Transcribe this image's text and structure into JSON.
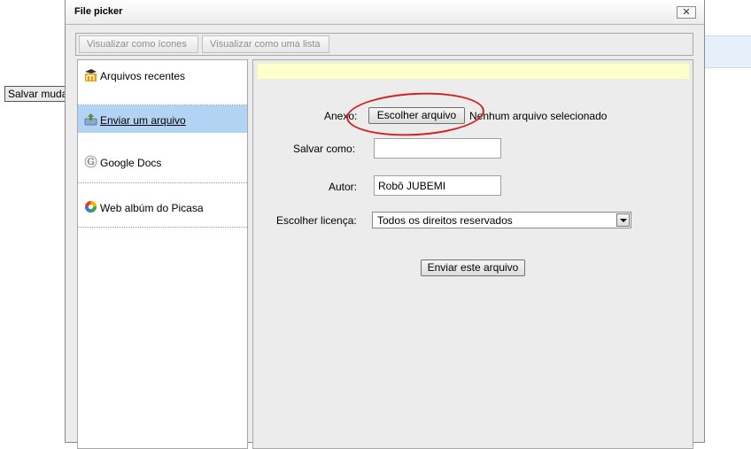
{
  "background": {
    "save_button_label": "Salvar mudanças"
  },
  "dialog": {
    "title": "File picker",
    "close_label": "✕"
  },
  "toolbar": {
    "view_icons_label": "Visualizar como ícones",
    "view_list_label": "Visualizar como uma lista"
  },
  "sidebar": {
    "items": [
      {
        "label": "Arquivos recentes",
        "icon": "moodle-icon",
        "active": false
      },
      {
        "label": "Enviar um arquivo",
        "icon": "upload-icon",
        "active": true
      },
      {
        "label": "Google Docs",
        "icon": "google-icon",
        "active": false
      },
      {
        "label": "Web albúm do Picasa",
        "icon": "picasa-icon",
        "active": false
      }
    ]
  },
  "form": {
    "attachment_label": "Anexo:",
    "choose_file_label": "Escolher arquivo",
    "no_file_text": "Nenhum arquivo selecionado",
    "save_as_label": "Salvar como:",
    "save_as_value": "",
    "author_label": "Autor:",
    "author_value": "Robô JUBEMI",
    "license_label": "Escolher licença:",
    "license_value": "Todos os direitos reservados",
    "submit_label": "Enviar este arquivo"
  },
  "colors": {
    "active_item": "#b3d3f5",
    "message_bar": "#ffffcc",
    "highlight_oval": "#d42020"
  }
}
